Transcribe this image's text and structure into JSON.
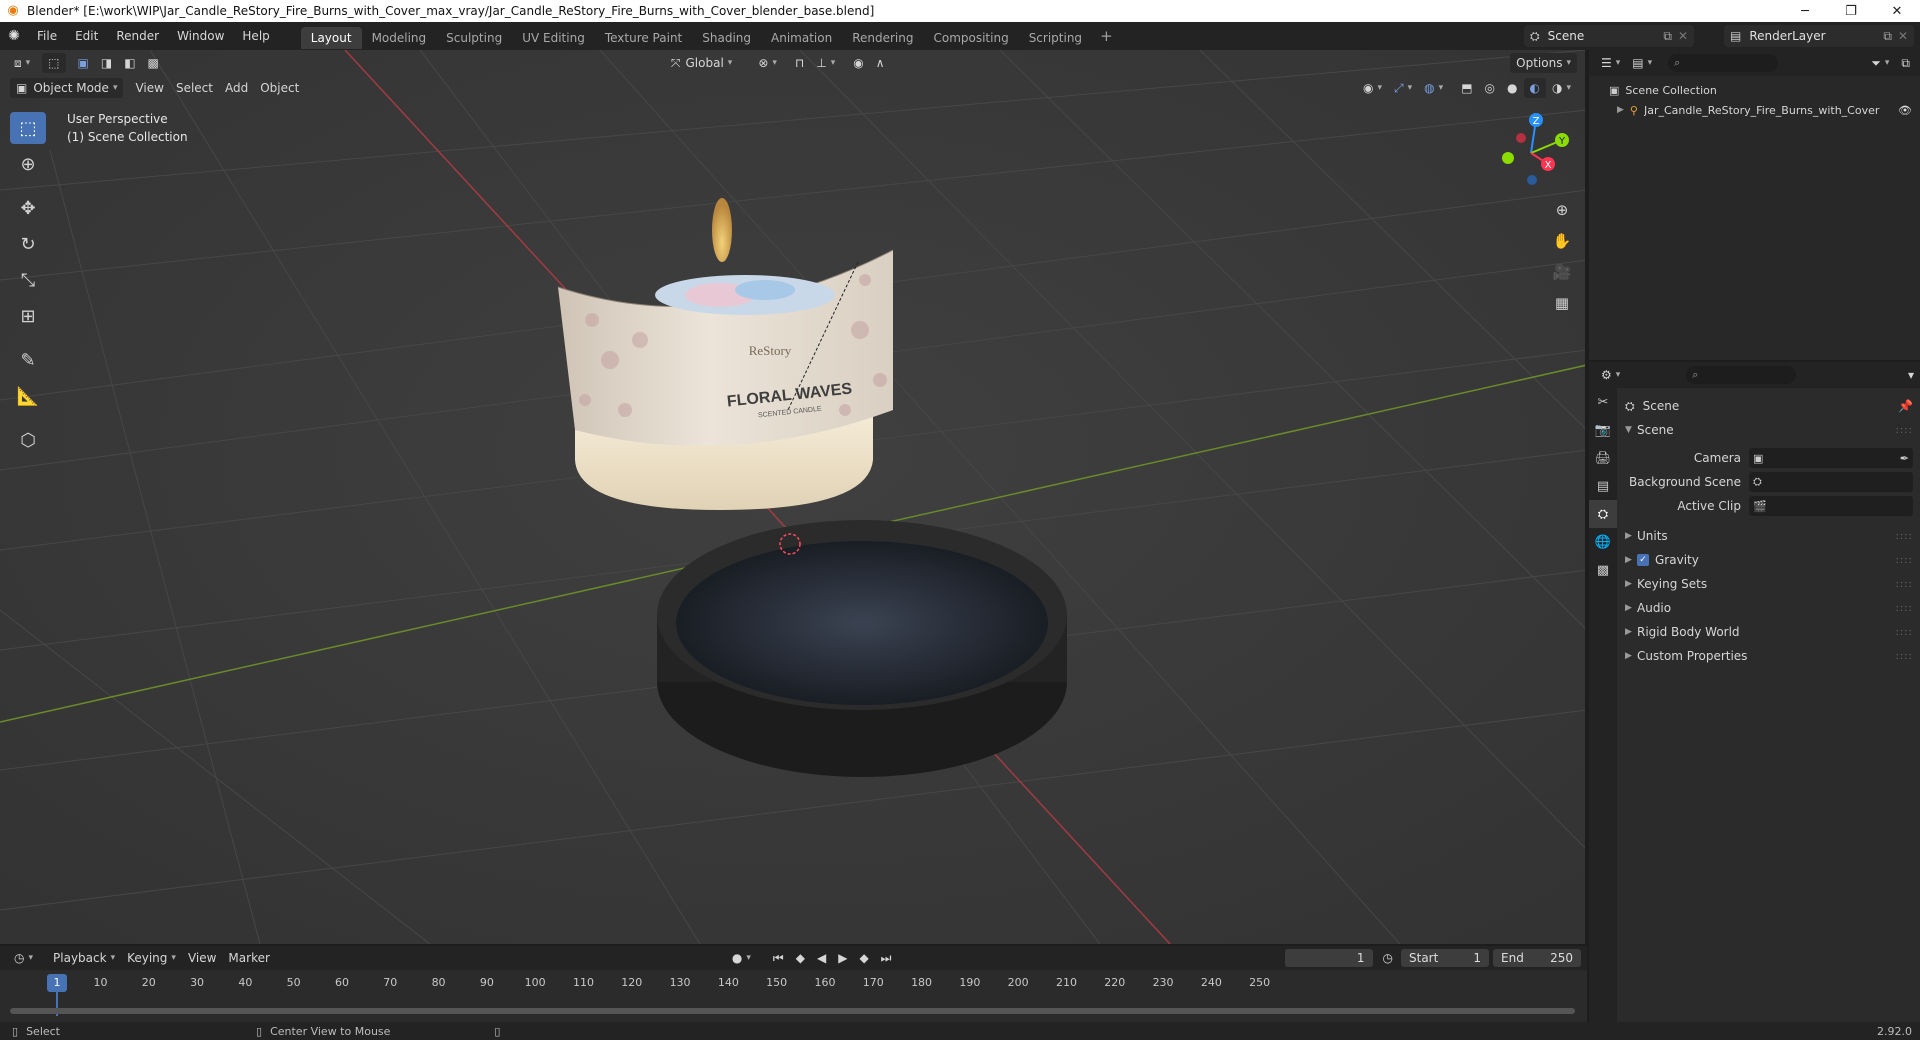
{
  "window": {
    "title": "Blender* [E:\\work\\WIP\\Jar_Candle_ReStory_Fire_Burns_with_Cover_max_vray/Jar_Candle_ReStory_Fire_Burns_with_Cover_blender_base.blend]",
    "minimize": "─",
    "restore": "❐",
    "close": "✕"
  },
  "menu": [
    "File",
    "Edit",
    "Render",
    "Window",
    "Help"
  ],
  "workspaces": [
    "Layout",
    "Modeling",
    "Sculpting",
    "UV Editing",
    "Texture Paint",
    "Shading",
    "Animation",
    "Rendering",
    "Compositing",
    "Scripting"
  ],
  "workspace_add": "+",
  "scene_selector": {
    "scene": "Scene",
    "view_layer": "RenderLayer"
  },
  "viewport": {
    "mode": "Object Mode",
    "menus": [
      "View",
      "Select",
      "Add",
      "Object"
    ],
    "transform_orientation": "Global",
    "options_label": "Options",
    "overlay_line1": "User Perspective",
    "overlay_line2": "(1) Scene Collection",
    "gizmo_labels": {
      "z": "Z",
      "y": "Y",
      "x": "X"
    },
    "label_brand": "ReStory",
    "label_title": "FLORAL WAVES",
    "label_subtitle": "SCENTED CANDLE"
  },
  "timeline": {
    "menus": [
      "Playback",
      "Keying",
      "View",
      "Marker"
    ],
    "current_frame": "1",
    "start_label": "Start",
    "start": "1",
    "end_label": "End",
    "end": "250",
    "ticks": [
      "10",
      "20",
      "30",
      "40",
      "50",
      "60",
      "70",
      "80",
      "90",
      "100",
      "110",
      "120",
      "130",
      "140",
      "150",
      "160",
      "170",
      "180",
      "190",
      "200",
      "210",
      "220",
      "230",
      "240",
      "250"
    ],
    "playhead": "1"
  },
  "status": {
    "left": "Select",
    "middle": "Center View to Mouse",
    "version": "2.92.0"
  },
  "outliner": {
    "root": "Scene Collection",
    "items": [
      "Jar_Candle_ReStory_Fire_Burns_with_Cover"
    ]
  },
  "properties": {
    "context": "Scene",
    "section": "Scene",
    "fields": [
      {
        "label": "Camera",
        "value": ""
      },
      {
        "label": "Background Scene",
        "value": ""
      },
      {
        "label": "Active Clip",
        "value": ""
      }
    ],
    "panels": [
      "Units",
      "Gravity",
      "Keying Sets",
      "Audio",
      "Rigid Body World",
      "Custom Properties"
    ]
  },
  "colors": {
    "accent": "#4772b3",
    "x_axis": "#ff3352",
    "y_axis": "#8bdc00",
    "z_axis": "#2890ff",
    "brand": "#e87d0d"
  }
}
